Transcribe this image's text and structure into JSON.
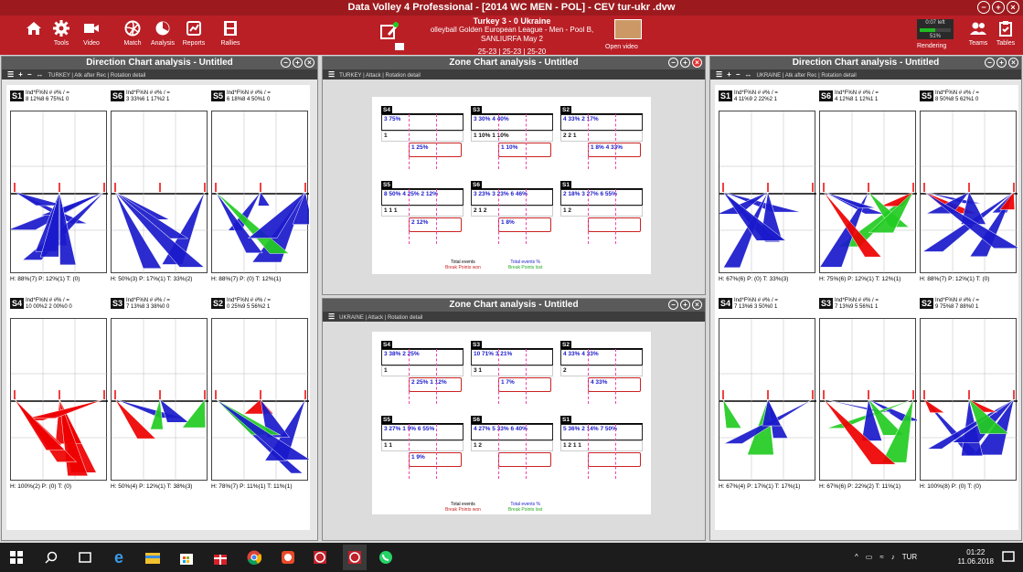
{
  "app": {
    "title": "Data Volley 4 Professional - [2014 WC MEN - POL] - CEV tur-ukr .dvw"
  },
  "ribbon": {
    "tools": "Tools",
    "video": "Video",
    "match": "Match",
    "analysis": "Analysis",
    "reports": "Reports",
    "rallies": "Rallies",
    "open_video": "Open video",
    "rendering": "Rendering",
    "teams": "Teams",
    "tables": "Tables",
    "time_left": "0:07 left",
    "pct": "51%"
  },
  "match": {
    "score_line": "Turkey  3 - 0  Ukraine",
    "league": "olleyball Golden European League - Men - Pool B, SANLIURFA May 2",
    "sets": "25-23 | 25-23 | 25-20"
  },
  "left_pane": {
    "title": "Direction Chart analysis - Untitled",
    "toolbar": "TURKEY  |  Atk after Rec  |  Rotation detail"
  },
  "right_pane": {
    "title": "Direction Chart analysis - Untitled",
    "toolbar": "UKRAINE  |  Atk after Rec  |  Rotation detail"
  },
  "zone_top": {
    "title": "Zone Chart analysis - Untitled",
    "toolbar": "TURKEY  |  Attack  |  Rotation detail"
  },
  "zone_bottom": {
    "title": "Zone Chart analysis - Untitled",
    "toolbar": "UKRAINE  |  Attack  |  Rotation detail"
  },
  "zone_legend": {
    "total_events": "Total events",
    "total_pct": "Total events %",
    "bp_won": "Break Points won",
    "bp_lost": "Break Points lost"
  },
  "left_cells": [
    {
      "rot": "S1",
      "stats": "Ind*F%N # #% / =",
      "vals": "8 12%8 6 75%1 0",
      "foot": "H: 88%(7)  P: 12%(1)  T: (0)"
    },
    {
      "rot": "S6",
      "stats": "Ind*F%N # #% / =",
      "vals": "3 33%6 1 17%2 1",
      "foot": "H: 50%(3)  P: 17%(1)  T: 33%(2)"
    },
    {
      "rot": "S5",
      "stats": "Ind*F%N # #% / =",
      "vals": "6 18%8 4 50%1 0",
      "foot": "H: 88%(7)  P: (0)  T: 12%(1)"
    },
    {
      "rot": "S4",
      "stats": "Ind*F%N # #% / =",
      "vals": "10 00%2 2 00%0 0",
      "foot": "H: 100%(2)  P: (0)  T: (0)"
    },
    {
      "rot": "S3",
      "stats": "Ind*F%N # #% / =",
      "vals": "7 13%8 3 38%0 0",
      "foot": "H: 50%(4)  P: 12%(1)  T: 38%(3)"
    },
    {
      "rot": "S2",
      "stats": "Ind*F%N # #% / =",
      "vals": "0 25%9 5 56%2 1",
      "foot": "H: 78%(7)  P: 11%(1)  T: 11%(1)"
    }
  ],
  "right_cells": [
    {
      "rot": "S1",
      "stats": "Ind*F%N # #% / =",
      "vals": "4 11%9 2 22%2 1",
      "foot": "H: 67%(6)  P: (0)  T: 33%(3)"
    },
    {
      "rot": "S6",
      "stats": "Ind*F%N # #% / =",
      "vals": "4 12%8 1 12%1 1",
      "foot": "H: 75%(6)  P: 12%(1)  T: 12%(1)"
    },
    {
      "rot": "S5",
      "stats": "Ind*F%N # #% / =",
      "vals": "8 50%8 5 62%1 0",
      "foot": "H: 88%(7)  P: 12%(1)  T: (0)"
    },
    {
      "rot": "S4",
      "stats": "Ind*F%N # #% / =",
      "vals": "7 13%6 3 50%0 1",
      "foot": "H: 67%(4)  P: 17%(1)  T: 17%(1)"
    },
    {
      "rot": "S3",
      "stats": "Ind*F%N # #% / =",
      "vals": "7 13%9 5 56%1 1",
      "foot": "H: 67%(6)  P: 22%(2)  T: 11%(1)"
    },
    {
      "rot": "S2",
      "stats": "Ind*F%N # #% / =",
      "vals": "9 75%8 7 88%0 1",
      "foot": "H: 100%(8)  P: (0)  T: (0)"
    }
  ],
  "zone_top_cells": [
    {
      "rot": "S4",
      "a": "3  75%",
      "b": "1",
      "c": "1  25%"
    },
    {
      "rot": "S3",
      "a": "3  30%   4  40%",
      "b": "1  10%   1  10%",
      "c": "1  10%"
    },
    {
      "rot": "S2",
      "a": "4  33%   2  17%",
      "b": "2  2   1",
      "c": "1  8%   4  33%"
    },
    {
      "rot": "S5",
      "a": "8  50%  4  25%  2  12%",
      "b": "1   1   1",
      "c": "2  12%"
    },
    {
      "rot": "S6",
      "a": "3  23%  3  23%  6  46%",
      "b": "2   1   2",
      "c": "1  8%"
    },
    {
      "rot": "S1",
      "a": "2  18%  3  27%  6  55%",
      "b": "1   2",
      "c": ""
    }
  ],
  "zone_bottom_cells": [
    {
      "rot": "S4",
      "a": "3  38%  2  25%",
      "b": "1",
      "c": "2  25%    1  12%"
    },
    {
      "rot": "S3",
      "a": "10  71%  3  21%",
      "b": "3   1",
      "c": "1  7%"
    },
    {
      "rot": "S2",
      "a": "4  33%  4  33%",
      "b": "2",
      "c": "4  33%"
    },
    {
      "rot": "S5",
      "a": "3  27%  1  9%  6  55%",
      "b": "1   1",
      "c": "1  9%"
    },
    {
      "rot": "S6",
      "a": "4  27%  5  33%  6  40%",
      "b": "1   2",
      "c": ""
    },
    {
      "rot": "S1",
      "a": "5  36%  2  14%  7  50%",
      "b": "1  2   1  1",
      "c": ""
    }
  ],
  "taskbar": {
    "lang": "TUR",
    "time": "01:22",
    "date": "11.06.2018"
  }
}
